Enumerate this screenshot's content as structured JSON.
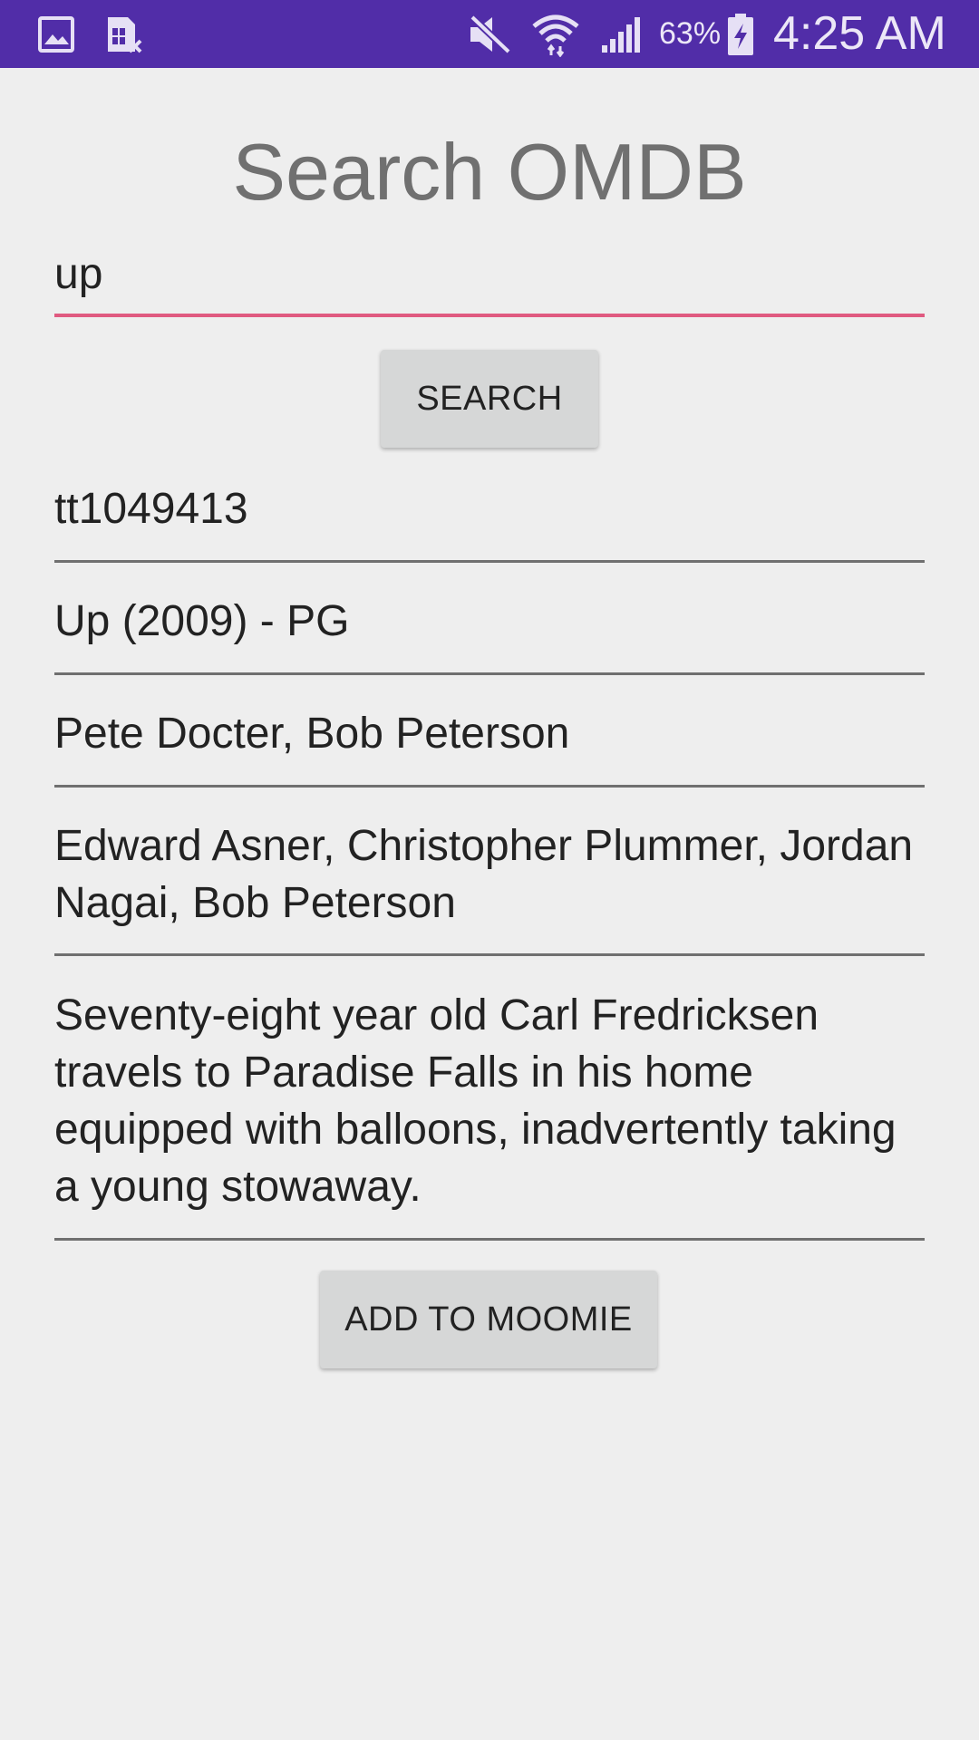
{
  "status_bar": {
    "battery": "63%",
    "time": "4:25 AM",
    "icons": [
      "gallery-icon",
      "sim-error-icon",
      "mute-icon",
      "wifi-icon",
      "signal-icon",
      "battery-charging-icon"
    ]
  },
  "page": {
    "title": "Search OMDB"
  },
  "search": {
    "value": "up",
    "button_label": "SEARCH"
  },
  "result": {
    "imdb_id": "tt1049413",
    "title_line": "Up (2009) - PG",
    "directors": "Pete Docter, Bob Peterson",
    "actors": "Edward Asner, Christopher Plummer, Jordan Nagai, Bob Peterson",
    "plot": "Seventy-eight year old Carl Fredricksen travels to Paradise Falls in his home equipped with balloons, inadvertently taking a young stowaway."
  },
  "actions": {
    "add_label": "ADD TO MOOMIE"
  },
  "colors": {
    "status_bar": "#512da8",
    "background": "#eeeeee",
    "input_underline": "#e05a80",
    "button": "#d6d7d7"
  }
}
